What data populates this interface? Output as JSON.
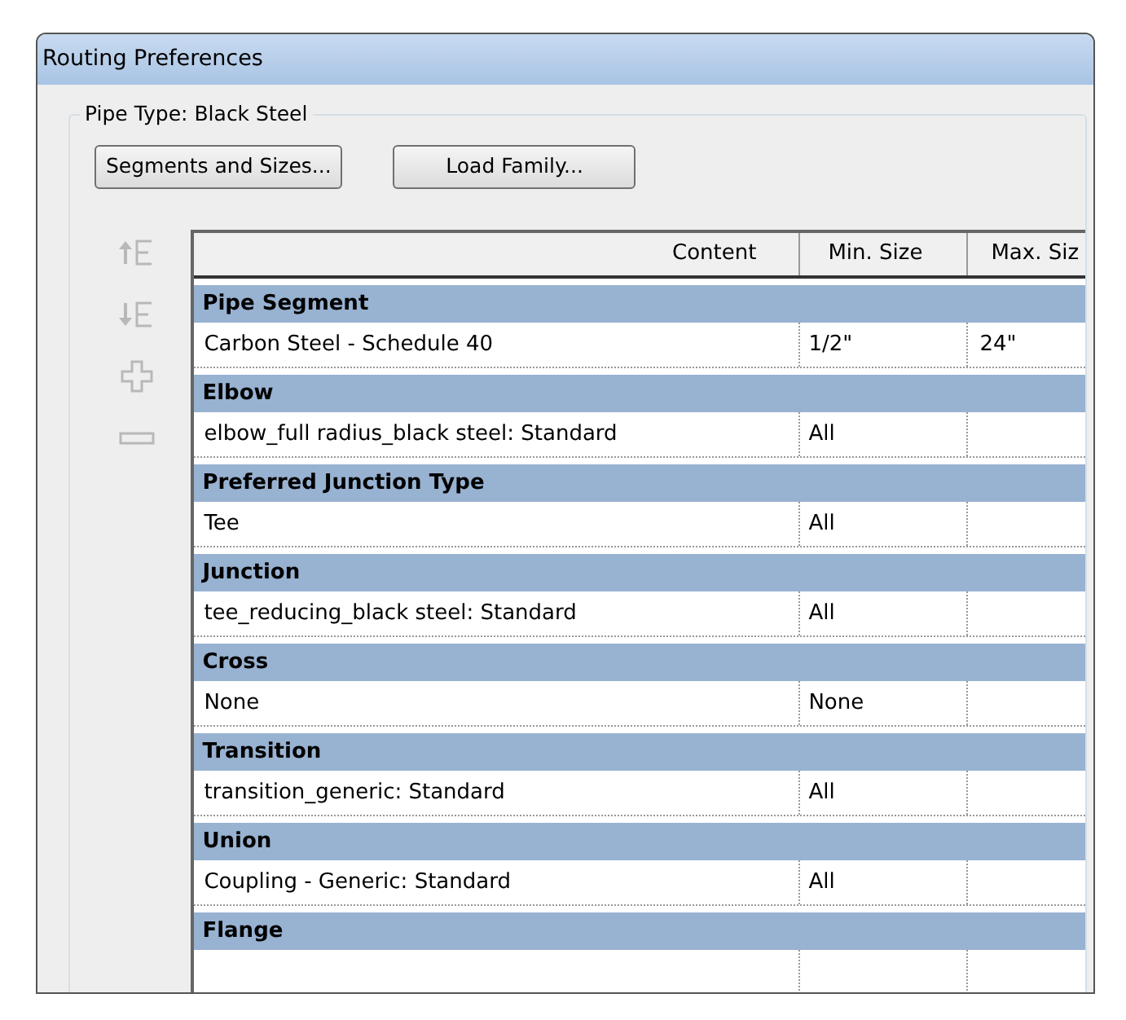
{
  "window": {
    "title": "Routing Preferences"
  },
  "group": {
    "label": "Pipe Type: Black Steel"
  },
  "buttons": [
    "Segments and Sizes...",
    "Load Family..."
  ],
  "side_tools": [
    {
      "kind": "up",
      "disabled": true
    },
    {
      "kind": "down",
      "disabled": true
    },
    {
      "kind": "add",
      "disabled": true
    },
    {
      "kind": "remove",
      "disabled": true
    }
  ],
  "table": {
    "columns": [
      "Content",
      "Min. Size",
      "Max. Siz"
    ],
    "groups": [
      {
        "name": "Pipe Segment",
        "rows": [
          [
            "Carbon Steel - Schedule 40",
            "1/2\"",
            "24\""
          ]
        ]
      },
      {
        "name": "Elbow",
        "rows": [
          [
            "elbow_full radius_black steel: Standard",
            "All",
            null
          ]
        ]
      },
      {
        "name": "Preferred Junction Type",
        "rows": [
          [
            "Tee",
            "All",
            null
          ]
        ]
      },
      {
        "name": "Junction",
        "rows": [
          [
            "tee_reducing_black steel: Standard",
            "All",
            null
          ]
        ]
      },
      {
        "name": "Cross",
        "rows": [
          [
            "None",
            "None",
            null
          ]
        ]
      },
      {
        "name": "Transition",
        "rows": [
          [
            "transition_generic: Standard",
            "All",
            null
          ]
        ]
      },
      {
        "name": "Union",
        "rows": [
          [
            "Coupling - Generic: Standard",
            "All",
            null
          ]
        ]
      },
      {
        "name": "Flange"
      }
    ]
  }
}
